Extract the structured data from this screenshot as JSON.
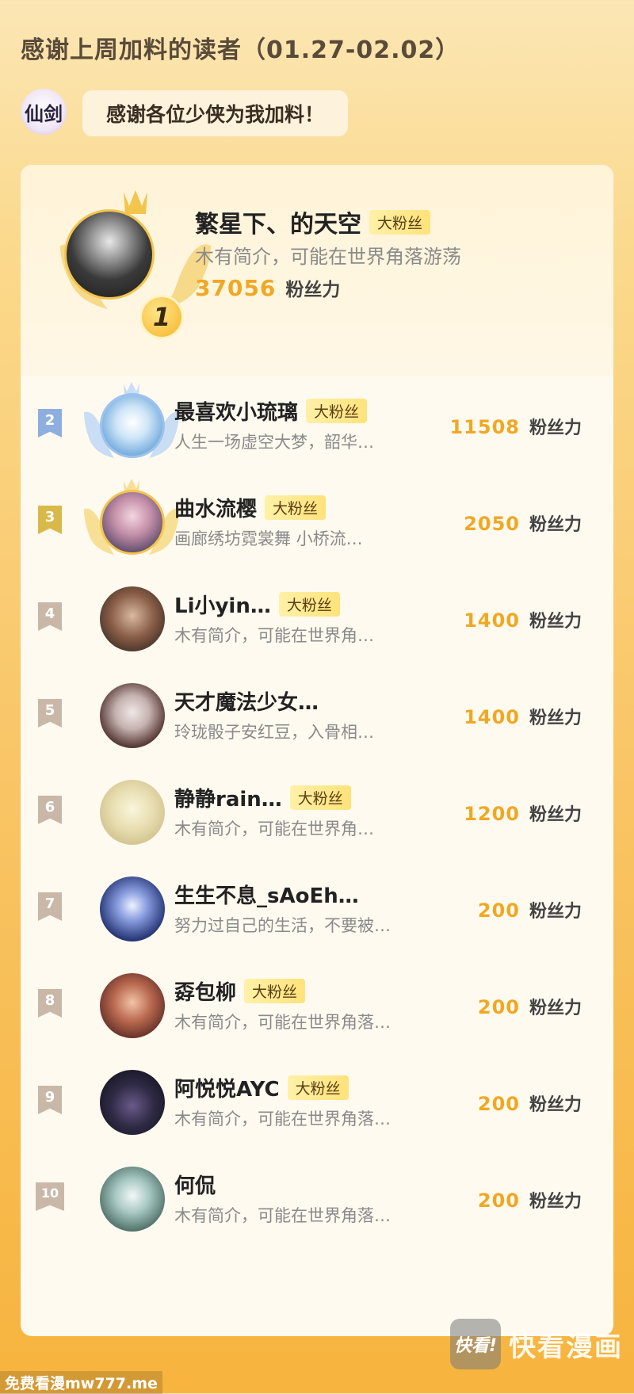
{
  "header": {
    "title": "感谢上周加料的读者（01.27-02.02）",
    "thanks_text": "感谢各位少侠为我加料！",
    "logo_text": "仙剑"
  },
  "top_fan": {
    "rank": "1",
    "name": "繁星下、的天空",
    "tag": "大粉丝",
    "desc": "木有简介，可能在世界角落游荡",
    "power": "37056",
    "power_unit": "粉丝力"
  },
  "fans": [
    {
      "rank": "2",
      "name": "最喜欢小琉璃",
      "tag": "大粉丝",
      "desc": "人生一场虚空大梦，韶华…",
      "power": "11508",
      "power_unit": "粉丝力"
    },
    {
      "rank": "3",
      "name": "曲水流樱",
      "tag": "大粉丝",
      "desc": "画廊绣坊霓裳舞 小桥流…",
      "power": "2050",
      "power_unit": "粉丝力"
    },
    {
      "rank": "4",
      "name": "Li小yin…",
      "tag": "大粉丝",
      "desc": "木有简介，可能在世界角…",
      "power": "1400",
      "power_unit": "粉丝力"
    },
    {
      "rank": "5",
      "name": "天才魔法少女…",
      "tag": "",
      "desc": "玲珑骰子安红豆，入骨相…",
      "power": "1400",
      "power_unit": "粉丝力"
    },
    {
      "rank": "6",
      "name": "静静rain…",
      "tag": "大粉丝",
      "desc": "木有简介，可能在世界角…",
      "power": "1200",
      "power_unit": "粉丝力"
    },
    {
      "rank": "7",
      "name": "生生不息_sAoEh…",
      "tag": "",
      "desc": "努力过自己的生活，不要被…",
      "power": "200",
      "power_unit": "粉丝力"
    },
    {
      "rank": "8",
      "name": "孬包柳",
      "tag": "大粉丝",
      "desc": "木有简介，可能在世界角落…",
      "power": "200",
      "power_unit": "粉丝力"
    },
    {
      "rank": "9",
      "name": "阿悦悦AYC",
      "tag": "大粉丝",
      "desc": "木有简介，可能在世界角落…",
      "power": "200",
      "power_unit": "粉丝力"
    },
    {
      "rank": "10",
      "name": "何侃",
      "tag": "",
      "desc": "木有简介，可能在世界角落…",
      "power": "200",
      "power_unit": "粉丝力"
    }
  ],
  "watermark": {
    "icon_text": "快看!",
    "text": "快看漫画"
  },
  "footer": {
    "site": "免费看漫mw777.me"
  },
  "colors": {
    "accent_orange": "#f0a823",
    "rank2_flag": "#8eaee0",
    "rank3_flag": "#d9b94a",
    "rank_other_flag": "#c9b8a8"
  }
}
